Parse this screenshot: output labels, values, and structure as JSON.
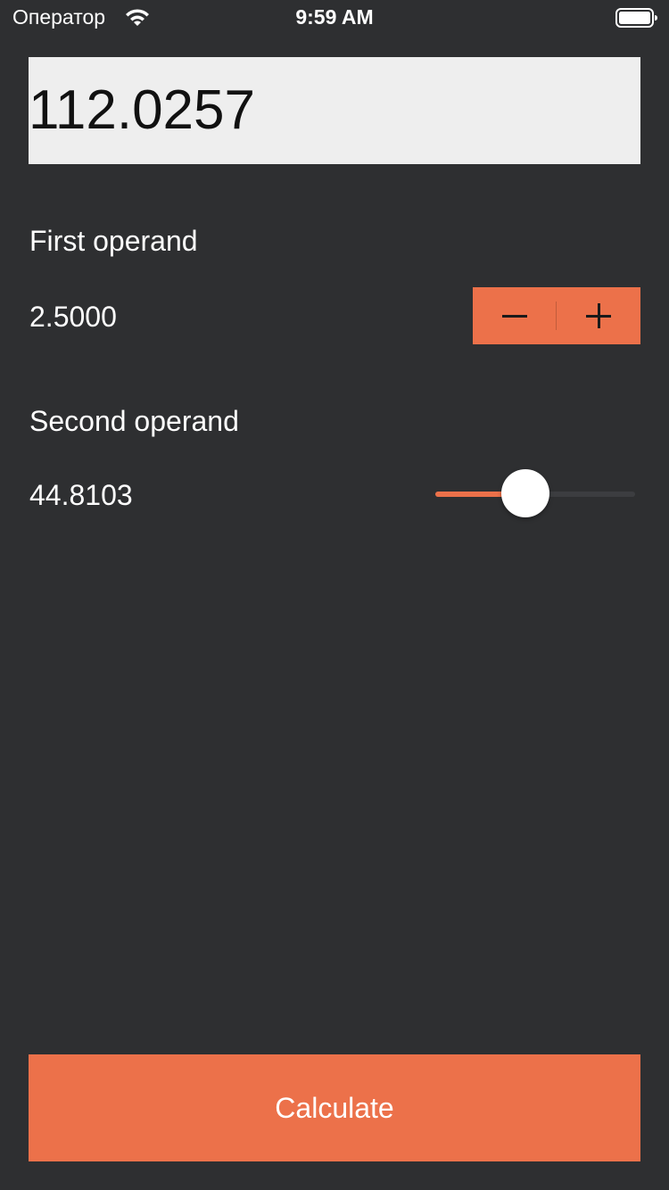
{
  "status_bar": {
    "carrier": "Оператор",
    "time": "9:59 AM",
    "wifi_icon": "wifi-icon",
    "battery_icon": "battery-full-icon"
  },
  "result": {
    "value": "112.0257"
  },
  "first_operand": {
    "label": "First operand",
    "value": "2.5000",
    "stepper": {
      "decrement_icon": "minus-icon",
      "increment_icon": "plus-icon"
    }
  },
  "second_operand": {
    "label": "Second operand",
    "value": "44.8103",
    "slider_fraction": 0.45
  },
  "actions": {
    "calculate_label": "Calculate"
  },
  "colors": {
    "background": "#2e2f31",
    "accent": "#ec714a",
    "display_background": "#eeeeee",
    "slider_track": "#3c3d40"
  }
}
